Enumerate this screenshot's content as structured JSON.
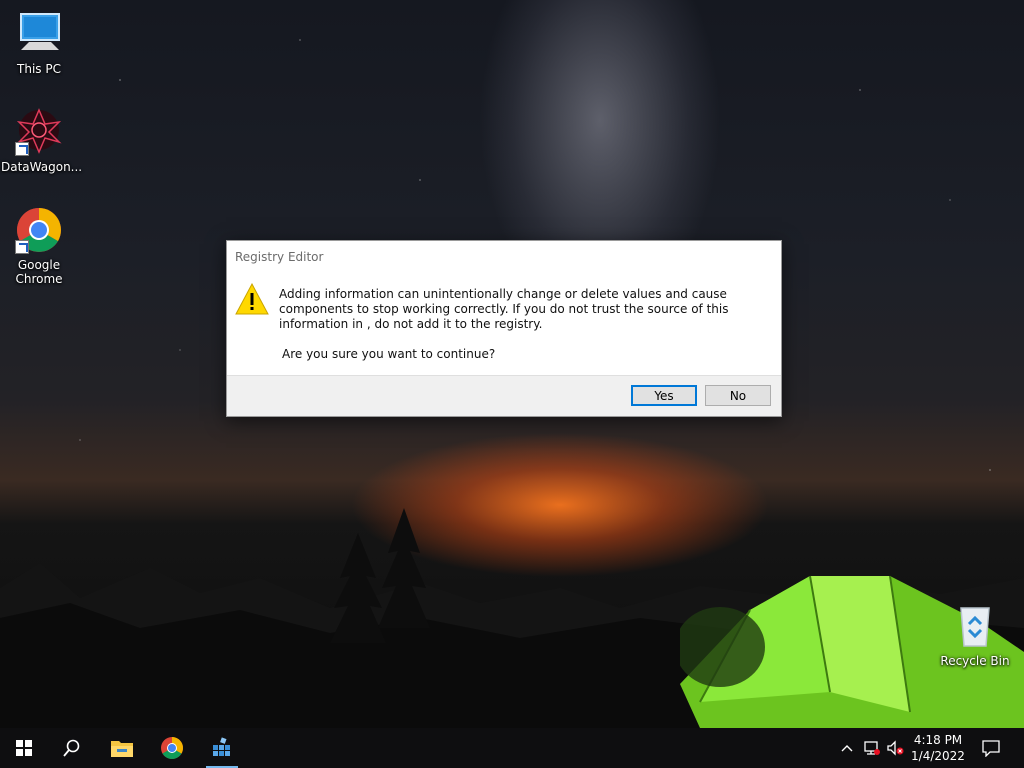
{
  "desktop": {
    "icons": [
      {
        "label": "This PC"
      },
      {
        "label": "DataWagon..."
      },
      {
        "label": "Google Chrome"
      },
      {
        "label": "Recycle Bin"
      }
    ]
  },
  "dialog": {
    "title": "Registry Editor",
    "message": "Adding information can unintentionally change or delete values and cause components to stop working correctly. If you do not trust the source of this information in , do not add it to the registry.",
    "question": "Are you sure you want to continue?",
    "yes_label": "Yes",
    "no_label": "No",
    "default_button": "Yes"
  },
  "taskbar": {
    "items": [
      {
        "icon": "windows-start-icon"
      },
      {
        "icon": "search-icon"
      },
      {
        "icon": "file-explorer-icon"
      },
      {
        "icon": "chrome-icon"
      },
      {
        "icon": "registry-editor-icon"
      }
    ],
    "tray": {
      "icons": [
        "chevron-up-icon",
        "network-icon",
        "volume-muted-icon",
        "notifications-icon"
      ],
      "time": "4:18 PM",
      "date": "1/4/2022"
    }
  },
  "colors": {
    "accent": "#0078d7",
    "taskbar": "#0e0e10",
    "tent": "#7ee02a"
  }
}
